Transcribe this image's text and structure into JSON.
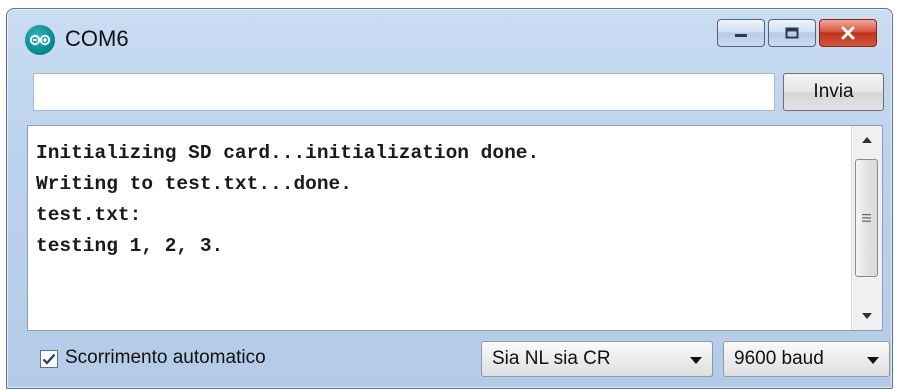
{
  "window": {
    "title": "COM6",
    "icon": "arduino-infinity-icon",
    "controls": {
      "minimize": "minimize-icon",
      "maximize": "maximize-icon",
      "close": "close-icon"
    }
  },
  "send": {
    "input_value": "",
    "button_label": "Invia"
  },
  "output": {
    "lines": [
      "Initializing SD card...initialization done.",
      "Writing to test.txt...done.",
      "test.txt:",
      "testing 1, 2, 3."
    ]
  },
  "footer": {
    "autoscroll_label": "Scorrimento automatico",
    "autoscroll_checked": true,
    "line_ending": "Sia NL sia CR",
    "baud_rate": "9600 baud"
  },
  "colors": {
    "frame": "#bcd2ec",
    "close_button": "#c1331c",
    "app_icon": "#00878f"
  }
}
